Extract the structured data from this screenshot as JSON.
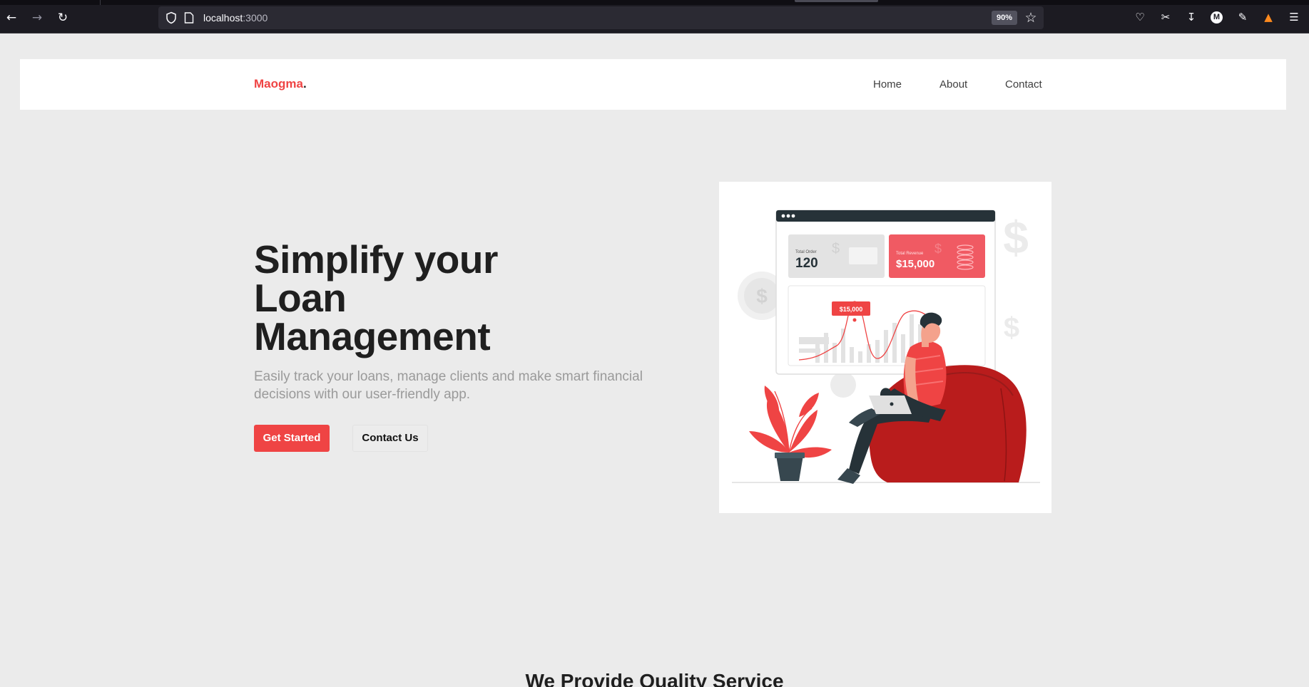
{
  "browser": {
    "url_host": "localhost",
    "url_port": ":3000",
    "zoom": "90%"
  },
  "site": {
    "logo_name": "Maogma",
    "logo_dot": ".",
    "nav": [
      "Home",
      "About",
      "Contact"
    ]
  },
  "hero": {
    "title_lines": [
      "Simplify your",
      "Loan",
      "Management"
    ],
    "subtitle": "Easily track your loans, manage clients and make smart financial decisions with our user-friendly app.",
    "primary_button": "Get Started",
    "secondary_button": "Contact Us"
  },
  "illustration": {
    "card1_label": "Total Order",
    "card1_value": "120",
    "card2_label": "Total Revenue",
    "card2_value": "$15,000",
    "chart_tag": "$15,000",
    "dollar_sign": "$",
    "accent_color": "#ef4444"
  },
  "section": {
    "title": "We Provide Quality Service"
  }
}
